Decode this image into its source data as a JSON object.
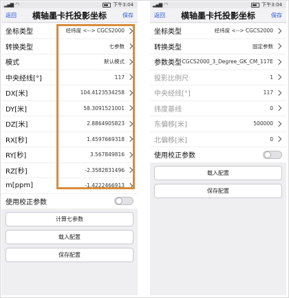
{
  "status": {
    "time": "下午3:04"
  },
  "left": {
    "back": "返回",
    "title": "横轴墨卡托投影坐标",
    "save": "保存",
    "rows": [
      {
        "label": "坐标类型",
        "value": "经纬度 <--> CGCS2000",
        "chevron": true
      },
      {
        "label": "转换类型",
        "value": "七参数",
        "chevron": true
      },
      {
        "label": "模式",
        "value": "默认模式",
        "chevron": true
      },
      {
        "label": "中央经线[°]",
        "value": "117",
        "chevron": true
      },
      {
        "label": "DX[米]",
        "value": "104.4123534258",
        "chevron": true
      },
      {
        "label": "DY[米]",
        "value": "58.3091521001",
        "chevron": true
      },
      {
        "label": "DZ[米]",
        "value": "2.8864905823",
        "chevron": true
      },
      {
        "label": "RX[秒]",
        "value": "1.4597669318",
        "chevron": true
      },
      {
        "label": "RY[秒]",
        "value": "3.567849816",
        "chevron": true
      },
      {
        "label": "RZ[秒]",
        "value": "-2.3582831496",
        "chevron": true
      },
      {
        "label": "m[ppm]",
        "value": "-1.4222466913",
        "chevron": true
      }
    ],
    "toggle_label": "使用校正参数",
    "buttons": [
      "计算七参数",
      "载入配置",
      "保存配置"
    ]
  },
  "right": {
    "back": "返回",
    "title": "横轴墨卡托投影坐标",
    "save": "保存",
    "rows": [
      {
        "label": "坐标类型",
        "value": "经纬度 <--> CGCS2000",
        "chevron": true,
        "disabled": false
      },
      {
        "label": "转换类型",
        "value": "固定参数",
        "chevron": true,
        "disabled": false
      },
      {
        "label": "参数类型",
        "value": "CGCS2000_3_Degree_GK_CM_117E",
        "chevron": true,
        "disabled": false
      },
      {
        "label": "投影比例尺",
        "value": "1",
        "chevron": true,
        "disabled": true
      },
      {
        "label": "中央经线[°]",
        "value": "117",
        "chevron": true,
        "disabled": true
      },
      {
        "label": "纬度基线",
        "value": "0",
        "chevron": true,
        "disabled": true
      },
      {
        "label": "东偏移[米]",
        "value": "500000",
        "chevron": true,
        "disabled": true
      },
      {
        "label": "北偏移[米]",
        "value": "0",
        "chevron": true,
        "disabled": true
      }
    ],
    "toggle_label": "使用校正参数",
    "buttons": [
      "载入配置",
      "保存配置"
    ]
  },
  "colors": {
    "accent": "#1e4fd8",
    "highlight": "#d98a3a"
  }
}
